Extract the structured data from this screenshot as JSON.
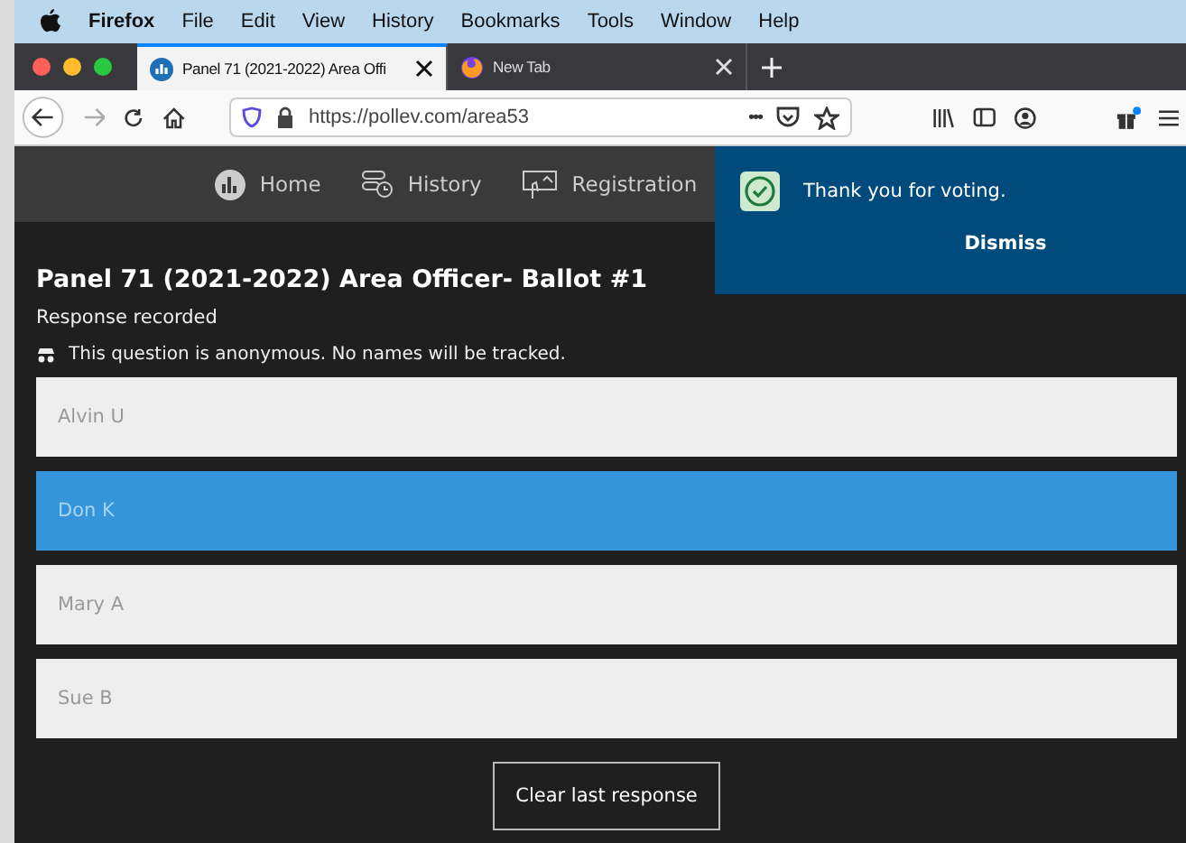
{
  "menu_bar": {
    "app": "Firefox",
    "items": [
      "File",
      "Edit",
      "View",
      "History",
      "Bookmarks",
      "Tools",
      "Window",
      "Help"
    ]
  },
  "tabs": [
    {
      "label": "Panel 71 (2021-2022) Area Offi",
      "selected": true
    },
    {
      "label": "New Tab",
      "selected": false
    }
  ],
  "address_bar": {
    "url": "https://pollev.com/area53",
    "more": "•••"
  },
  "nav": [
    {
      "label": "Home"
    },
    {
      "label": "History"
    },
    {
      "label": "Registration"
    }
  ],
  "toast": {
    "message": "Thank you for voting.",
    "action": "Dismiss"
  },
  "poll": {
    "title": "Panel 71 (2021-2022) Area Officer- Ballot #1",
    "status": "Response recorded",
    "notice": "This question is anonymous. No names will be tracked.",
    "options": [
      {
        "label": "Alvin U",
        "selected": false
      },
      {
        "label": "Don K",
        "selected": true
      },
      {
        "label": "Mary A",
        "selected": false
      },
      {
        "label": "Sue B",
        "selected": false
      }
    ],
    "clear_button": "Clear last response"
  }
}
